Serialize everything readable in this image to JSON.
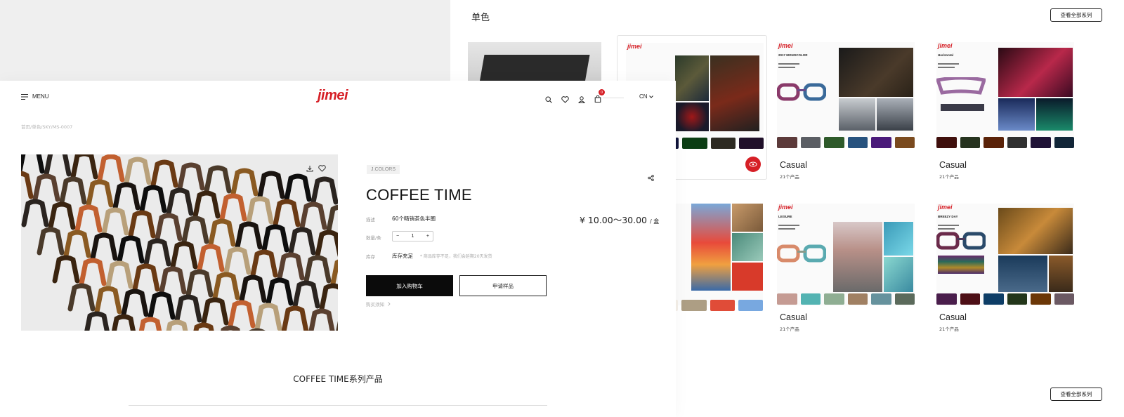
{
  "catalog": {
    "section_title": "单色",
    "view_all_label": "查看全部系列",
    "cards": [
      {
        "title": "",
        "count": ""
      },
      {
        "title": "",
        "count": ""
      },
      {
        "title": "Casual",
        "count": "21个产品",
        "tiny_heading": "2017 MONOCOLOR",
        "swatches": [
          "#5c3a3a",
          "#5b5e64",
          "#2e5a2a",
          "#27527e",
          "#4a1a7a",
          "#7a4a1e"
        ]
      },
      {
        "title": "Casual",
        "count": "21个产品",
        "tiny_heading": "Horizontal",
        "swatches": [
          "#3f0f0c",
          "#26331f",
          "#5a2208",
          "#303030",
          "#1f1236",
          "#122638"
        ]
      },
      {
        "title": "",
        "count": ""
      },
      {
        "title": "Casual",
        "count": "21个产品",
        "tiny_heading": "LEISURE",
        "swatches": [
          "#c59b93",
          "#53b3b2",
          "#8fae93",
          "#a08063",
          "#66929d",
          "#5b6a5b"
        ]
      },
      {
        "title": "Casual",
        "count": "21个产品",
        "tiny_heading": "BREEZY DAY",
        "swatches": [
          "#4a1e4c",
          "#4d0f16",
          "#0d3d66",
          "#23361a",
          "#6b3707",
          "#6b5963"
        ]
      }
    ],
    "partial_swatches_top": [
      "#3a0e0e",
      "#10143a",
      "#0b3d13",
      "#2d2a22",
      "#20102a"
    ],
    "partial_swatches_bottom": [
      "#7a5aa6",
      "#f4efe8",
      "#ad9e84",
      "#e04c38",
      "#78a8e0"
    ]
  },
  "header": {
    "menu_label": "MENU",
    "brand": "jimei",
    "cart_count": "0",
    "language": "CN"
  },
  "breadcrumb": "首页/单色/SKY/MS-0007",
  "product": {
    "tag": "J.COLORS",
    "title": "COFFEE TIME",
    "desc_label": "描述",
    "desc_value": "60个畅销茶色半圈",
    "qty_label": "数量/条",
    "qty_value": "1",
    "stock_label": "库存",
    "stock_value": "库存充足",
    "stock_note": "* 商品库存不足，我们会延期20天发货",
    "price": "¥ 10.00～30.00",
    "price_unit": "/ 盒",
    "add_to_cart": "加入购物车",
    "request_sample": "申请样品",
    "buy_note": "购买须知"
  },
  "series_title": "COFFEE TIME系列产品",
  "colors": {
    "brand_red": "#d61f26",
    "primary_button": "#0b0b0b"
  }
}
